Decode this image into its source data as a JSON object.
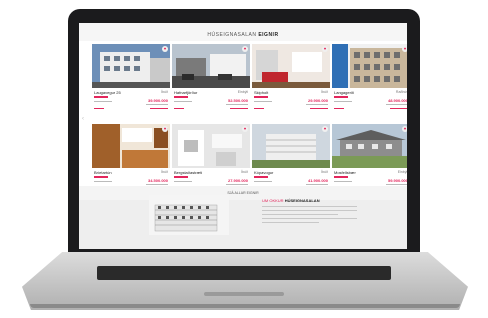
{
  "site": {
    "logo_light": "HÚSEIGNASALAN",
    "logo_bold": "EIGNIR"
  },
  "listings": [
    {
      "street": "Laugavegur 25",
      "type": "Íbúð",
      "price": "39.900.000",
      "photo": "white-apartment-block"
    },
    {
      "street": "Hafnarfjörður",
      "type": "Einbýli",
      "price": "52.500.000",
      "photo": "parking-lot-houses"
    },
    {
      "street": "Skipholt",
      "type": "Íbúð",
      "price": "29.900.000",
      "photo": "red-interior-room"
    },
    {
      "street": "Langagerði",
      "type": "Raðhús",
      "price": "48.900.000",
      "photo": "blue-building-facade"
    },
    {
      "street": "Bríetartún",
      "type": "Íbúð",
      "price": "34.500.000",
      "photo": "wooden-kitchen"
    },
    {
      "street": "Bergstaðastræti",
      "type": "Íbúð",
      "price": "27.900.000",
      "photo": "white-bathroom"
    },
    {
      "street": "Kópavogur",
      "type": "Íbúð",
      "price": "41.900.000",
      "photo": "apartment-complex"
    },
    {
      "street": "Mosfellsbær",
      "type": "Einbýli",
      "price": "59.900.000",
      "photo": "grey-house-lawn"
    }
  ],
  "more_button": "SJÁ ALLAR EIGNIR",
  "featured": {
    "title_light": "UM OKKUR",
    "title_bold": "HÚSEIGNASALAN"
  },
  "colors": {
    "accent": "#e3265c",
    "bezel": "#1b1b1d",
    "aluminium": "#c8c8c8"
  }
}
